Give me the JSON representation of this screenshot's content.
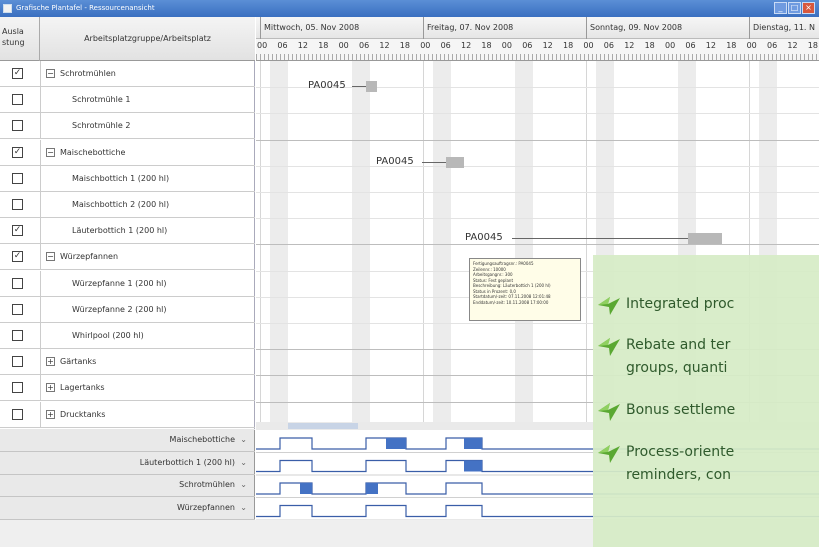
{
  "window": {
    "title": "Grafische Plantafel - Ressourcenansicht"
  },
  "table": {
    "col1_header": "Ausla stung",
    "col2_header": "Arbeitsplatzgruppe/Arbeitsplatz",
    "rows": [
      {
        "label": "Schrotmühlen",
        "checked": true,
        "group": true,
        "exp": "−"
      },
      {
        "label": "Schrotmühle 1",
        "checked": false,
        "group": false
      },
      {
        "label": "Schrotmühle 2",
        "checked": false,
        "group": false
      },
      {
        "label": "Maischebottiche",
        "checked": true,
        "group": true,
        "exp": "−"
      },
      {
        "label": "Maischbottich 1 (200 hl)",
        "checked": false,
        "group": false
      },
      {
        "label": "Maischbottich 2 (200 hl)",
        "checked": false,
        "group": false
      },
      {
        "label": "Läuterbottich 1 (200 hl)",
        "checked": true,
        "group": false
      },
      {
        "label": "Würzepfannen",
        "checked": true,
        "group": true,
        "exp": "−"
      },
      {
        "label": "Würzepfanne 1 (200 hl)",
        "checked": false,
        "group": false
      },
      {
        "label": "Würzepfanne 2 (200 hl)",
        "checked": false,
        "group": false
      },
      {
        "label": "Whirlpool (200 hl)",
        "checked": false,
        "group": false
      },
      {
        "label": "Gärtanks",
        "checked": false,
        "group": true,
        "exp": "+"
      },
      {
        "label": "Lagertanks",
        "checked": false,
        "group": true,
        "exp": "+"
      },
      {
        "label": "Drucktanks",
        "checked": false,
        "group": true,
        "exp": "+"
      }
    ]
  },
  "timeline": {
    "days": [
      "Mittwoch, 05. Nov 2008",
      "Freitag, 07. Nov 2008",
      "Sonntag, 09. Nov 2008",
      "Dienstag, 11. N"
    ],
    "hours": [
      "00",
      "06",
      "12",
      "18"
    ],
    "orders": [
      {
        "label": "PA0045"
      },
      {
        "label": "PA0045"
      },
      {
        "label": "PA0045"
      }
    ],
    "tooltip": [
      "Fertigungsauftragsnr.: PA0045",
      "Zeilennr.: 10000",
      "Arbeitsgangnr.: 300",
      "Status: Fest geplant",
      "Beschreibung: Läuterbottich 1 (200 hl)",
      "Status in Prozent: 0,0",
      "Startdatum/-zeit: 07.11.2008 12:01:48",
      "Enddatum/-zeit: 10.11.2008 17:00:00"
    ]
  },
  "load": {
    "rows": [
      "Maischebottiche",
      "Läuterbottich 1 (200 hl)",
      "Schrotmühlen",
      "Würzepfannen"
    ],
    "arrow": "⌄"
  },
  "features": [
    "Integrated proc",
    "Rebate and ter",
    "groups, quanti",
    "Bonus settleme",
    "Process-oriente",
    "reminders, con"
  ],
  "colors": {
    "accent": "#4472c4",
    "overlay": "#d6ecc6",
    "tick_green": "#5aa832"
  }
}
